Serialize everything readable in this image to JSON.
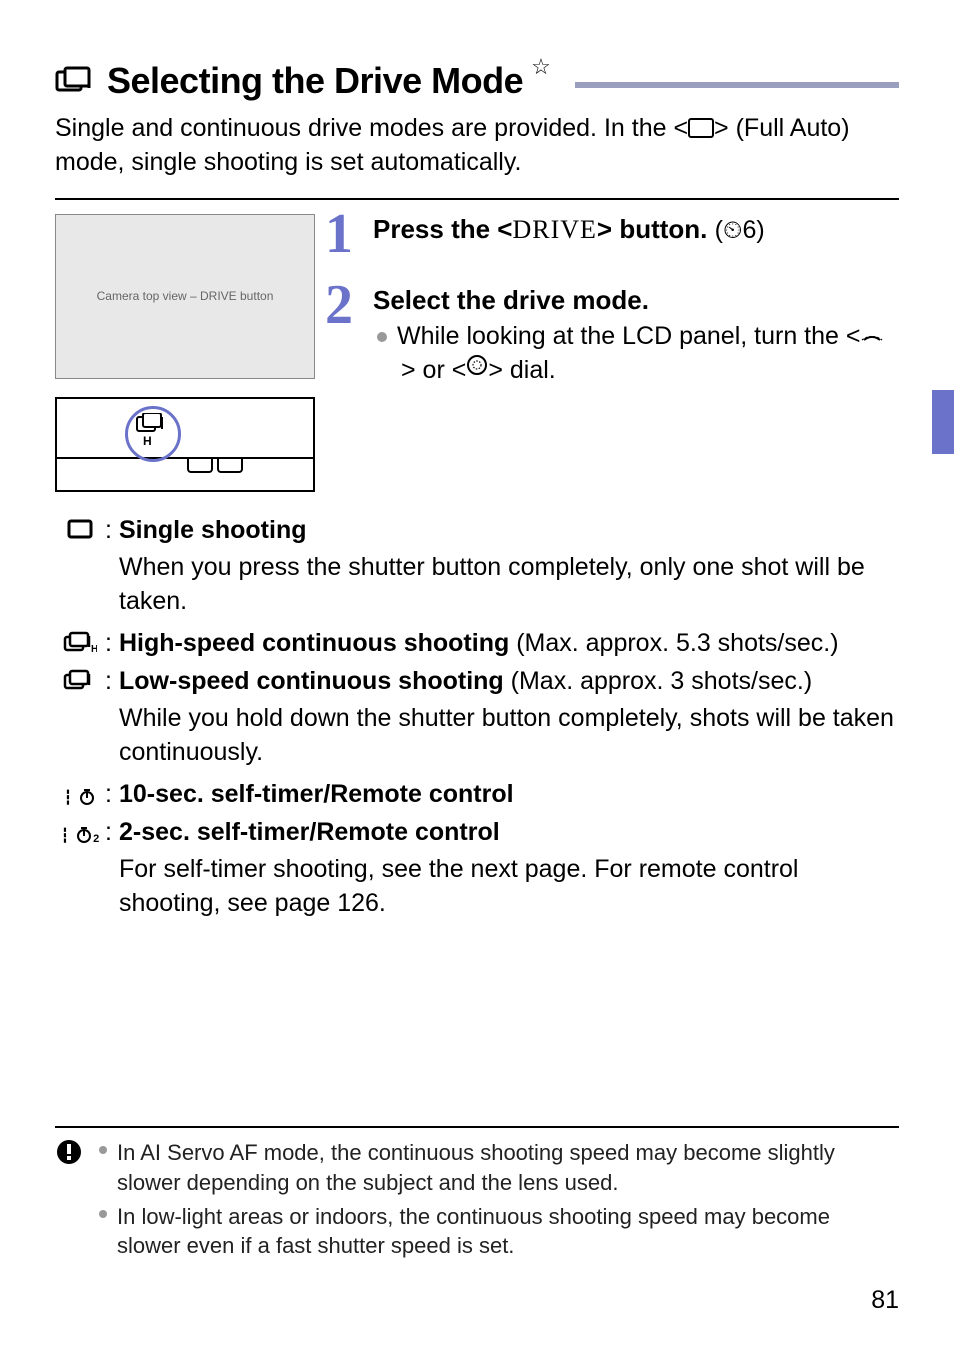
{
  "title": {
    "text": "Selecting the Drive Mode",
    "icon_name": "drive-mode-icon",
    "star_char": "☆"
  },
  "intro": {
    "line1": "Single and continuous drive modes are provided. In the <",
    "line1_icon_name": "full-auto-rect-icon",
    "line1_after": "> (Full Auto) mode, single shooting is set automatically."
  },
  "step1": {
    "num": "1",
    "title_before": "Press the <",
    "drive_word": "DRIVE",
    "title_after": "> button.",
    "timer_note": "(⏲6)"
  },
  "step2": {
    "num": "2",
    "title": "Select the drive mode.",
    "body_before": "While looking at the LCD panel, turn the <",
    "icon1_name": "main-dial-icon",
    "body_mid": "> or <",
    "icon2_name": "quick-control-dial-icon",
    "body_after": "> dial."
  },
  "modes": {
    "single": {
      "icon_name": "single-shooting-icon",
      "title": "Single shooting",
      "desc": "When you press the shutter button completely, only one shot will be taken."
    },
    "high": {
      "icon_name": "high-speed-continuous-icon",
      "title": "High-speed continuous shooting",
      "note": " (Max. approx. 5.3 shots/sec.)"
    },
    "low": {
      "icon_name": "low-speed-continuous-icon",
      "title": "Low-speed continuous shooting",
      "note": " (Max. approx. 3 shots/sec.)",
      "desc": "While you hold down the shutter button completely, shots will be taken continuously."
    },
    "timer10": {
      "icon_name": "self-timer-10-icon",
      "title": "10-sec. self-timer/Remote control"
    },
    "timer2": {
      "icon_name": "self-timer-2-icon",
      "title": "2-sec. self-timer/Remote control",
      "desc": "For self-timer shooting, see the next page. For remote control shooting, see page 126."
    }
  },
  "notes": {
    "item1": "In AI Servo AF mode, the continuous shooting speed may become slightly slower depending on the subject and the lens used.",
    "item2": "In low-light areas or indoors, the continuous shooting speed may become slower even if a fast shutter speed is set."
  },
  "page_number": "81",
  "images": {
    "step_img_alt": "Camera top view – DRIVE button"
  }
}
